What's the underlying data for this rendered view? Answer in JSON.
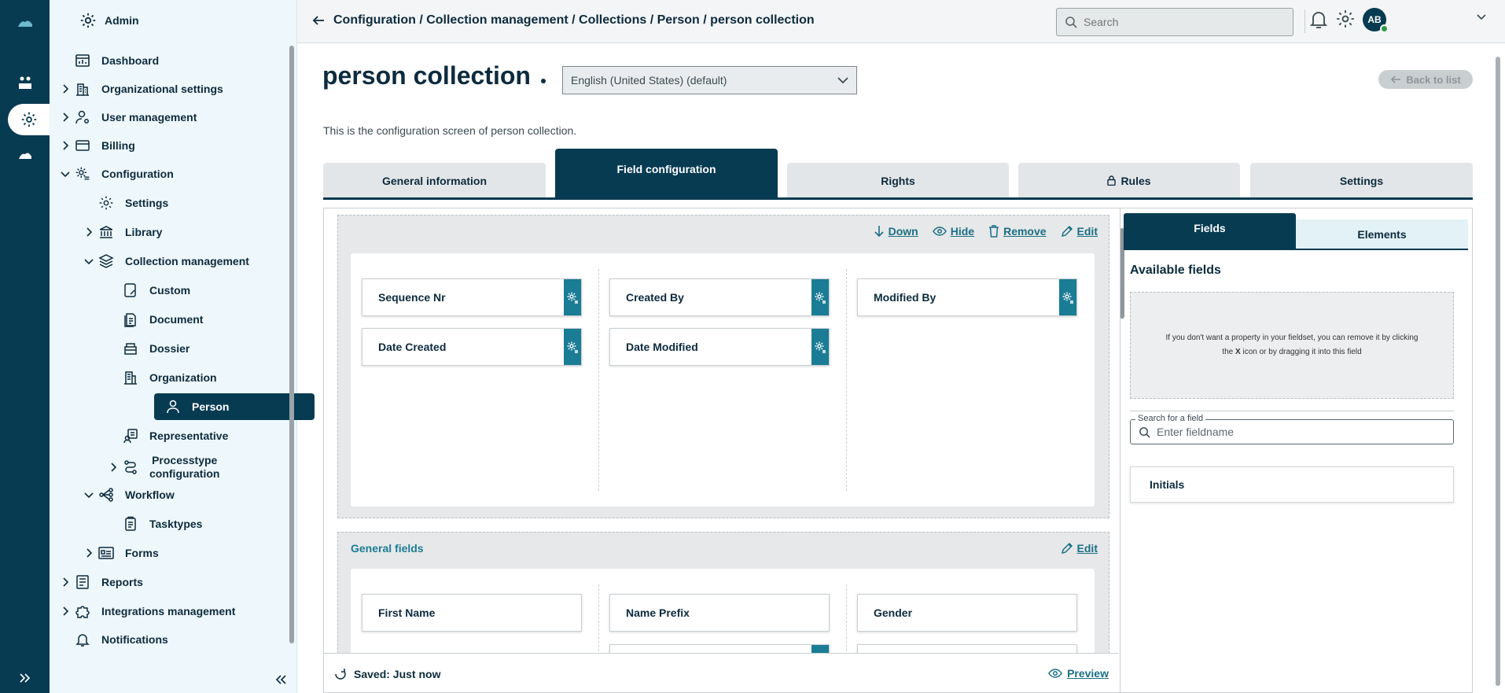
{
  "breadcrumb": [
    "Configuration",
    "Collection management",
    "Collections",
    "Person",
    "person collection"
  ],
  "breadcrumb_text": "Configuration / Collection management / Collections / Person / person collection",
  "search": {
    "placeholder": "Search"
  },
  "user": {
    "initials": "AB"
  },
  "sidebar": {
    "admin_label": "Admin",
    "items": [
      {
        "label": "Dashboard",
        "icon": "dashboard-icon"
      },
      {
        "label": "Organizational settings",
        "icon": "building-icon"
      },
      {
        "label": "User management",
        "icon": "user-gear-icon"
      },
      {
        "label": "Billing",
        "icon": "card-icon"
      },
      {
        "label": "Configuration",
        "icon": "gear-cog-icon"
      },
      {
        "label": "Settings",
        "icon": "gear-icon"
      },
      {
        "label": "Library",
        "icon": "library-icon"
      },
      {
        "label": "Collection management",
        "icon": "layers-icon"
      },
      {
        "label": "Custom",
        "icon": "custom-doc-icon"
      },
      {
        "label": "Document",
        "icon": "document-icon"
      },
      {
        "label": "Dossier",
        "icon": "dossier-icon"
      },
      {
        "label": "Organization",
        "icon": "organization-icon"
      },
      {
        "label": "Person",
        "icon": "person-icon"
      },
      {
        "label": "Representative",
        "icon": "representative-icon"
      },
      {
        "label": "Processtype configuration",
        "line1": "Processtype",
        "line2": "configuration",
        "icon": "process-icon"
      },
      {
        "label": "Workflow",
        "icon": "workflow-icon"
      },
      {
        "label": "Tasktypes",
        "icon": "clipboard-icon"
      },
      {
        "label": "Forms",
        "icon": "form-icon"
      },
      {
        "label": "Reports",
        "icon": "report-icon"
      },
      {
        "label": "Integrations management",
        "icon": "puzzle-icon"
      },
      {
        "label": "Notifications",
        "icon": "bell-icon"
      }
    ]
  },
  "page": {
    "title": "person collection",
    "language": "English (United States) (default)",
    "back_label": "Back to list",
    "description": "This is the configuration screen of person collection."
  },
  "tabs": [
    {
      "label": "General information"
    },
    {
      "label": "Field configuration",
      "active": true
    },
    {
      "label": "Rights"
    },
    {
      "label": "Rules",
      "icon": "lock-icon"
    },
    {
      "label": "Settings"
    }
  ],
  "section1": {
    "actions": {
      "down": "Down",
      "hide": "Hide",
      "remove": "Remove",
      "edit": "Edit"
    },
    "fields": [
      "Sequence Nr",
      "Created By",
      "Modified By",
      "Date Created",
      "Date Modified"
    ]
  },
  "section2": {
    "title": "General fields",
    "edit": "Edit",
    "fields": [
      "First Name",
      "Name Prefix",
      "Gender"
    ]
  },
  "footer": {
    "saved": "Saved: Just now",
    "preview": "Preview"
  },
  "right_panel": {
    "tab_fields": "Fields",
    "tab_elements": "Elements",
    "heading": "Available fields",
    "dropzone_text_pre": "If you don't want a property in your fieldset, you can remove it by clicking the ",
    "dropzone_text_x": "X",
    "dropzone_text_post": " icon or by dragging it into this field",
    "search_label": "Search for a field",
    "search_placeholder": "Enter fieldname",
    "available": [
      "Initials"
    ]
  },
  "colors": {
    "primary": "#073b52",
    "accent": "#1b7c95",
    "sidebar_bg": "#eef7fb"
  }
}
